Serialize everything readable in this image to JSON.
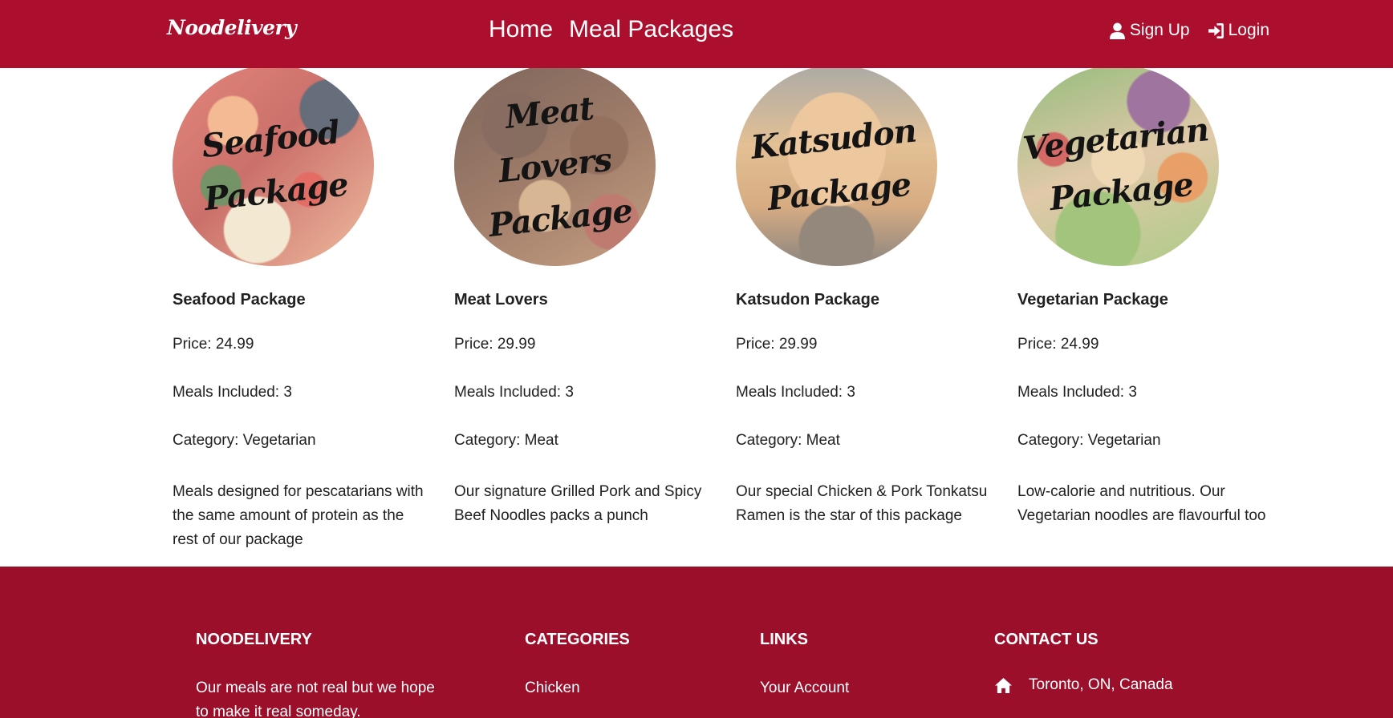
{
  "navbar": {
    "brand": "Noodelivery",
    "links": [
      "Home",
      "Meal Packages"
    ],
    "sign_up": "Sign Up",
    "login": "Login",
    "bg_color": "#ab0f2d",
    "icons": [
      "user-icon",
      "sign-in-icon"
    ]
  },
  "packages": [
    {
      "image_text": [
        "Seafood",
        "Package"
      ],
      "name": "Seafood Package",
      "price": "Price: 24.99",
      "meals": "Meals Included: 3",
      "category": "Category: Vegetarian",
      "description": "Meals designed for pescatarians with the same amount of protein as the rest of our package"
    },
    {
      "image_text": [
        "Meat Lovers",
        "Package"
      ],
      "name": "Meat Lovers",
      "price": "Price: 29.99",
      "meals": "Meals Included: 3",
      "category": "Category: Meat",
      "description": "Our signature Grilled Pork and Spicy Beef Noodles packs a punch"
    },
    {
      "image_text": [
        "Katsudon",
        "Package"
      ],
      "name": "Katsudon Package",
      "price": "Price: 29.99",
      "meals": "Meals Included: 3",
      "category": "Category: Meat",
      "description": "Our special Chicken & Pork Tonkatsu Ramen is the star of this package"
    },
    {
      "image_text": [
        "Vegetarian",
        "Package"
      ],
      "name": "Vegetarian Package",
      "price": "Price: 24.99",
      "meals": "Meals Included: 3",
      "category": "Category: Vegetarian",
      "description": "Low-calorie and nutritious. Our Vegetarian noodles are flavourful too"
    }
  ],
  "footer": {
    "about_heading": "NOODELIVERY",
    "about_text": "Our meals are not real but we hope to make it real someday.",
    "categories_heading": "CATEGORIES",
    "categories_first": "Chicken",
    "links_heading": "LINKS",
    "links_first": "Your Account",
    "contact_heading": "CONTACT US",
    "contact_address": "Toronto, ON, Canada",
    "bg_color": "#9b0f2b",
    "contact_icon": "home-icon"
  }
}
